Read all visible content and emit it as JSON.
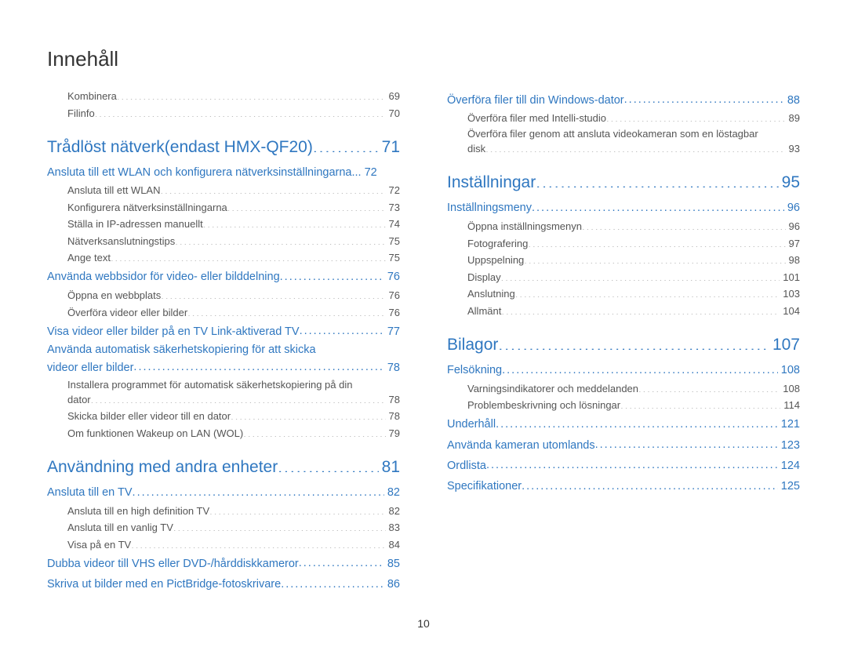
{
  "title": "Innehåll",
  "page_number": "10",
  "left": [
    {
      "level": "sub",
      "label": "Kombinera",
      "page": "69"
    },
    {
      "level": "sub",
      "label": "Filinfo",
      "page": "70"
    },
    {
      "level": "chapter",
      "label": "Trådlöst nätverk(endast HMX-QF20)",
      "page": "71"
    },
    {
      "level": "section",
      "label": "Ansluta till ett WLAN och konfigurera nätverksinställningarna",
      "page": "72",
      "sep": " ... "
    },
    {
      "level": "sub",
      "label": "Ansluta till ett WLAN",
      "page": "72"
    },
    {
      "level": "sub",
      "label": "Konfigurera nätverksinställningarna",
      "page": "73"
    },
    {
      "level": "sub",
      "label": "Ställa in IP-adressen manuellt",
      "page": "74"
    },
    {
      "level": "sub",
      "label": "Nätverksanslutningstips",
      "page": "75"
    },
    {
      "level": "sub",
      "label": "Ange text",
      "page": "75"
    },
    {
      "level": "section",
      "label": "Använda webbsidor för video- eller bilddelning",
      "page": "76"
    },
    {
      "level": "sub",
      "label": "Öppna en webbplats",
      "page": "76"
    },
    {
      "level": "sub",
      "label": "Överföra videor eller bilder",
      "page": "76"
    },
    {
      "level": "section",
      "label": "Visa videor eller bilder på en TV Link-aktiverad TV",
      "page": "77"
    },
    {
      "level": "section-multi",
      "first": "Använda automatisk säkerhetskopiering för att skicka",
      "label": "videor eller bilder",
      "page": "78"
    },
    {
      "level": "sub-multi",
      "first": "Installera programmet för automatisk säkerhetskopiering på din",
      "label": "dator",
      "page": "78"
    },
    {
      "level": "sub",
      "label": "Skicka bilder eller videor till en dator",
      "page": "78"
    },
    {
      "level": "sub",
      "label": "Om funktionen Wakeup on LAN (WOL)",
      "page": "79"
    },
    {
      "level": "chapter",
      "label": "Användning med andra enheter",
      "page": "81"
    },
    {
      "level": "section",
      "label": "Ansluta till en TV",
      "page": "82"
    },
    {
      "level": "sub",
      "label": "Ansluta till en high definition TV",
      "page": "82"
    },
    {
      "level": "sub",
      "label": "Ansluta till en vanlig TV",
      "page": "83"
    },
    {
      "level": "sub",
      "label": "Visa på en TV",
      "page": "84"
    },
    {
      "level": "section",
      "label": "Dubba videor till VHS eller DVD-/hårddiskkameror",
      "page": "85"
    },
    {
      "level": "section",
      "label": "Skriva ut bilder med en PictBridge-fotoskrivare",
      "page": "86"
    }
  ],
  "right": [
    {
      "level": "section",
      "label": "Överföra filer till din Windows-dator",
      "page": "88"
    },
    {
      "level": "sub",
      "label": "Överföra filer med Intelli-studio",
      "page": "89"
    },
    {
      "level": "sub-multi",
      "first": "Överföra filer genom att ansluta videokameran som en löstagbar",
      "label": "disk",
      "page": "93"
    },
    {
      "level": "chapter",
      "label": "Inställningar",
      "page": "95"
    },
    {
      "level": "section",
      "label": "Inställningsmeny",
      "page": "96"
    },
    {
      "level": "sub",
      "label": "Öppna inställningsmenyn",
      "page": "96"
    },
    {
      "level": "sub",
      "label": "Fotografering",
      "page": "97"
    },
    {
      "level": "sub",
      "label": "Uppspelning",
      "page": "98"
    },
    {
      "level": "sub",
      "label": "Display",
      "page": "101"
    },
    {
      "level": "sub",
      "label": "Anslutning",
      "page": "103"
    },
    {
      "level": "sub",
      "label": "Allmänt",
      "page": "104"
    },
    {
      "level": "chapter",
      "label": "Bilagor",
      "page": "107"
    },
    {
      "level": "section",
      "label": "Felsökning",
      "page": "108"
    },
    {
      "level": "sub",
      "label": "Varningsindikatorer och meddelanden",
      "page": "108"
    },
    {
      "level": "sub",
      "label": "Problembeskrivning och lösningar",
      "page": "114"
    },
    {
      "level": "section",
      "label": "Underhåll",
      "page": "121"
    },
    {
      "level": "section",
      "label": "Använda kameran utomlands",
      "page": "123"
    },
    {
      "level": "section",
      "label": "Ordlista",
      "page": "124"
    },
    {
      "level": "section",
      "label": "Specifikationer",
      "page": "125"
    }
  ]
}
